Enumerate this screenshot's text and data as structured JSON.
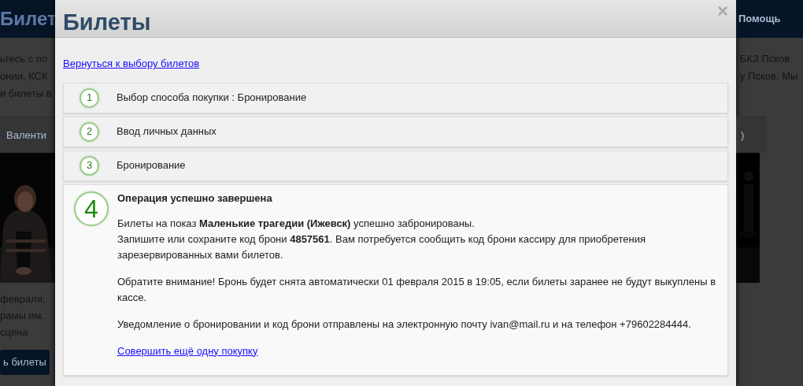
{
  "background": {
    "header_title": "Билет",
    "header_menu": "Помощь",
    "left_lines": [
      "ьтесь с по",
      "онии, КСК",
      "и билеты в"
    ],
    "right_lines": [
      "БКЗ Псков",
      "у Псков. Мы"
    ],
    "tab_left": "Валенти",
    "tab_right": ")",
    "left_caption_lines": [
      "февраля,",
      "рамы им.",
      "сцена"
    ],
    "buy_button": "ь билеты"
  },
  "modal": {
    "title": "Билеты",
    "close": "×",
    "back_link": "Вернуться к выбору билетов",
    "steps": [
      {
        "number": "1",
        "label": "Выбор способа покупки : Бронирование",
        "expanded": false
      },
      {
        "number": "2",
        "label": "Ввод личных данных",
        "expanded": false
      },
      {
        "number": "3",
        "label": "Бронирование",
        "expanded": false
      },
      {
        "number": "4",
        "label": "Операция успешно завершена",
        "expanded": true,
        "paragraphs": [
          [
            "Билеты на показ **Маленькие трагедии (Ижевск)** успешно забронированы.",
            "Запишите или сохраните код брони **4857561**. Вам потребуется сообщить код брони кассиру для приобретения зарезервированных вами билетов."
          ],
          [
            "Обратите внимание! Бронь будет снята автоматически 01 февраля 2015 в 19:05, если билеты заранее не будут выкуплены в кассе."
          ],
          [
            "Уведомление о бронировании и код брони отправлены на электронную почту ivan@mail.ru и на телефон +79602284444."
          ]
        ],
        "link": "Совершить ещё одну покупку"
      }
    ]
  }
}
